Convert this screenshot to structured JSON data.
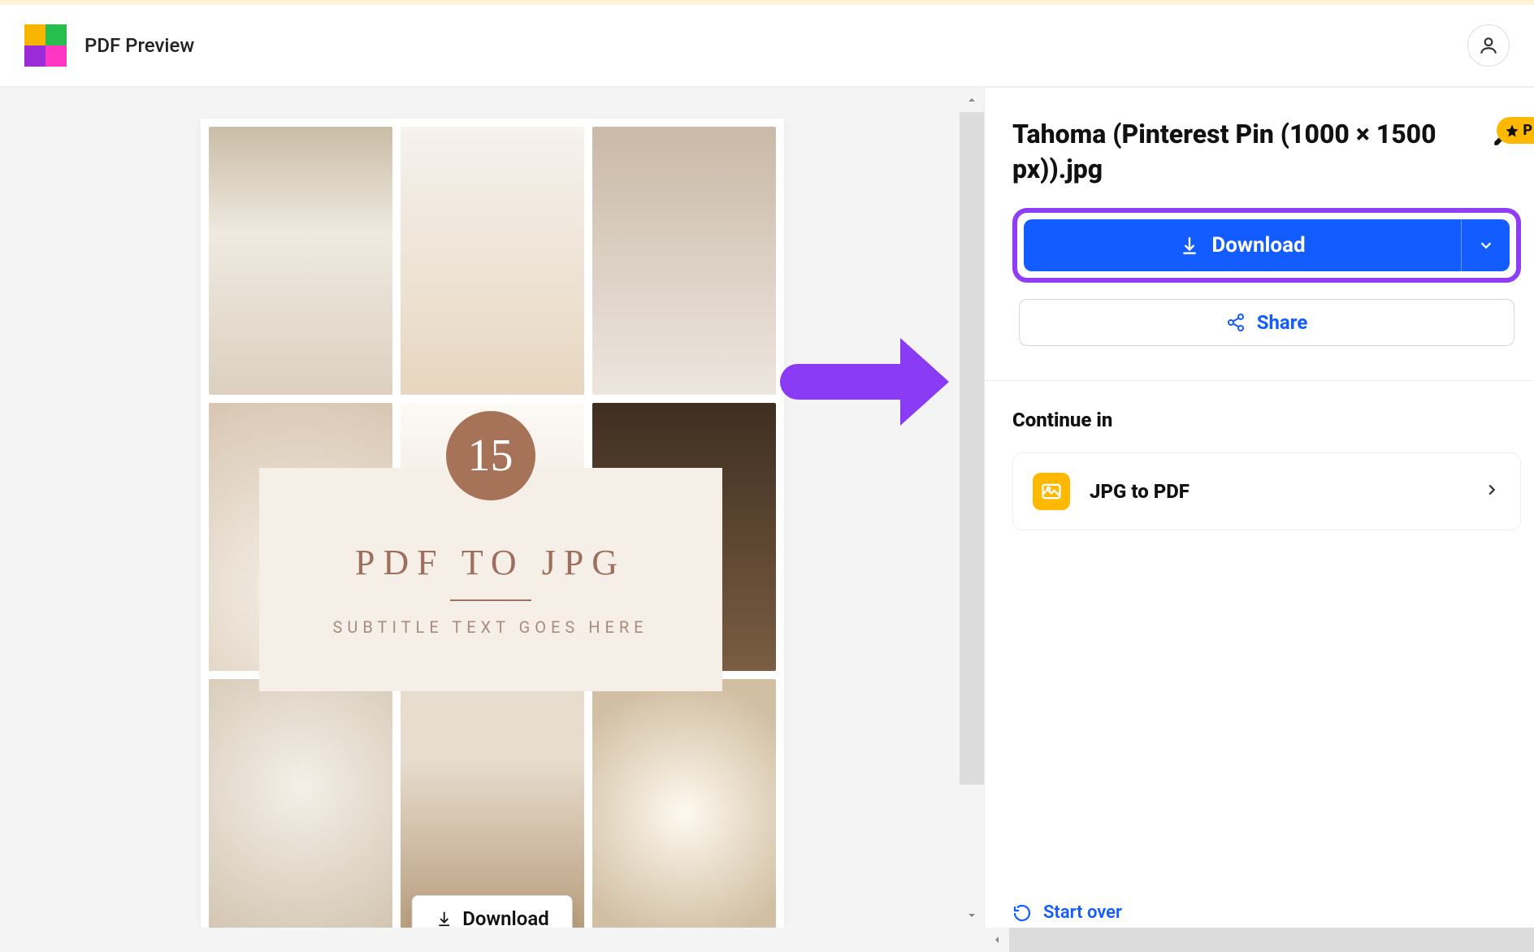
{
  "header": {
    "title": "PDF Preview"
  },
  "preview": {
    "badge_number": "15",
    "title": "PDF TO JPG",
    "subtitle": "SUBTITLE TEXT GOES HERE",
    "hover_download_label": "Download"
  },
  "sidebar": {
    "file_name": "Tahoma (Pinterest Pin (1000 × 1500 px)).jpg",
    "pro_label": "P",
    "download_label": "Download",
    "share_label": "Share",
    "continue_label": "Continue in",
    "tools": [
      {
        "name": "JPG to PDF"
      }
    ],
    "start_over_label": "Start over"
  }
}
